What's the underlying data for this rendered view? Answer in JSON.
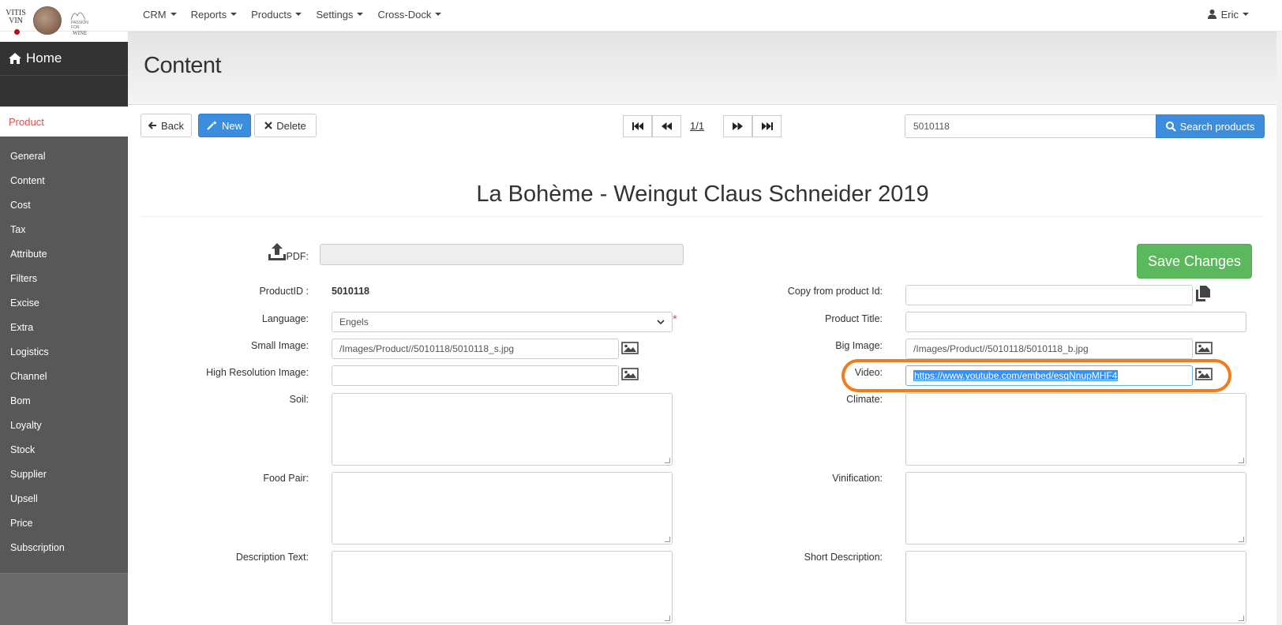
{
  "logo": {
    "line1": "VITIS",
    "line2": "VIN",
    "passion_small": "PASSION FOR",
    "passion_wine": "WINE"
  },
  "nav": {
    "items": [
      {
        "label": "CRM"
      },
      {
        "label": "Reports"
      },
      {
        "label": "Products"
      },
      {
        "label": "Settings"
      },
      {
        "label": "Cross-Dock"
      }
    ],
    "user": "Eric"
  },
  "sidebar": {
    "home": "Home",
    "section": "Product",
    "items": [
      {
        "label": "General"
      },
      {
        "label": "Content"
      },
      {
        "label": "Cost"
      },
      {
        "label": "Tax"
      },
      {
        "label": "Attribute"
      },
      {
        "label": "Filters"
      },
      {
        "label": "Excise"
      },
      {
        "label": "Extra"
      },
      {
        "label": "Logistics"
      },
      {
        "label": "Channel"
      },
      {
        "label": "Bom"
      },
      {
        "label": "Loyalty"
      },
      {
        "label": "Stock"
      },
      {
        "label": "Supplier"
      },
      {
        "label": "Upsell"
      },
      {
        "label": "Price"
      },
      {
        "label": "Subscription"
      }
    ]
  },
  "page": {
    "title": "Content"
  },
  "toolbar": {
    "back": "Back",
    "new": "New",
    "delete": "Delete",
    "pager": "1/1",
    "search_value": "5010118",
    "search_button": "Search products"
  },
  "product": {
    "title": "La Bohème - Weingut Claus Schneider 2019"
  },
  "form": {
    "pdf_label": "PDF:",
    "save": "Save Changes",
    "product_id_label": "ProductID :",
    "product_id": "5010118",
    "language_label": "Language:",
    "language": "Engels",
    "small_image_label": "Small Image:",
    "small_image": "/Images/Product//5010118/5010118_s.jpg",
    "hires_label": "High Resolution Image:",
    "hires": "",
    "soil_label": "Soil:",
    "food_pair_label": "Food Pair:",
    "description_label": "Description Text:",
    "copy_label": "Copy from product Id:",
    "product_title_label": "Product Title:",
    "big_image_label": "Big Image:",
    "big_image": "/Images/Product//5010118/5010118_b.jpg",
    "video_label": "Video:",
    "video": "https://www.youtube.com/embed/esqNnupMHF4",
    "climate_label": "Climate:",
    "vinification_label": "Vinification:",
    "short_description_label": "Short Description:"
  },
  "colors": {
    "primary": "#3c8dde",
    "success": "#5cb85c",
    "danger": "#d9534f",
    "highlight": "#f07c1d"
  }
}
